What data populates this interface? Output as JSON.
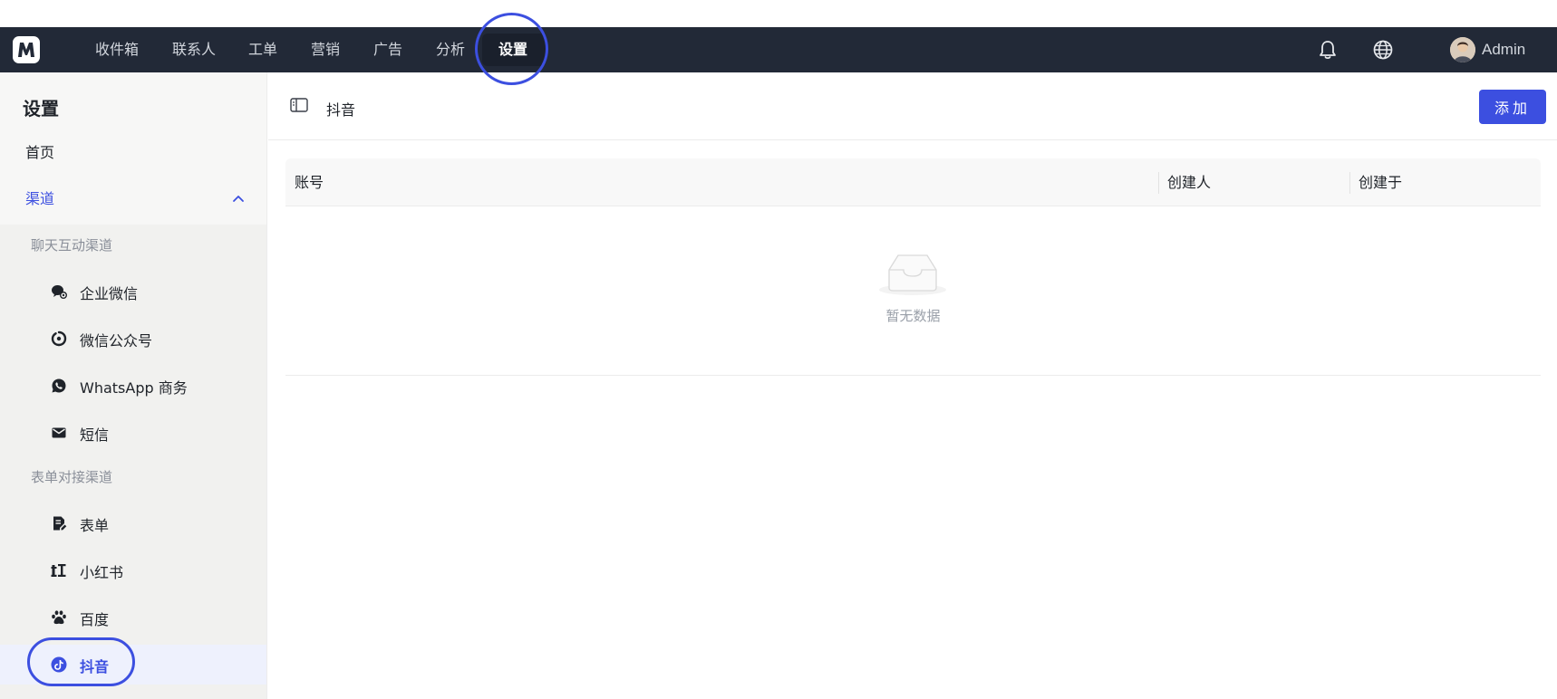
{
  "topnav": {
    "items": [
      "收件箱",
      "联系人",
      "工单",
      "营销",
      "广告",
      "分析",
      "设置"
    ],
    "active_label": "设置",
    "user_name": "Admin"
  },
  "sidebar": {
    "title": "设置",
    "home_label": "首页",
    "channels_label": "渠道",
    "chat_group_label": "聊天互动渠道",
    "chat_channels": [
      {
        "label": "企业微信",
        "icon": "wecom-icon"
      },
      {
        "label": "微信公众号",
        "icon": "wechat-official-icon"
      },
      {
        "label": "WhatsApp 商务",
        "icon": "whatsapp-icon"
      },
      {
        "label": "短信",
        "icon": "sms-icon"
      }
    ],
    "form_group_label": "表单对接渠道",
    "form_channels": [
      {
        "label": "表单",
        "icon": "form-icon"
      },
      {
        "label": "小红书",
        "icon": "xiaohongshu-icon"
      },
      {
        "label": "百度",
        "icon": "baidu-icon"
      },
      {
        "label": "抖音",
        "icon": "douyin-icon"
      }
    ],
    "active_channel": "抖音"
  },
  "main": {
    "title": "抖音",
    "add_button": "添加",
    "table": {
      "columns": [
        "账号",
        "创建人",
        "创建于"
      ],
      "rows": [],
      "empty_text": "暂无数据"
    }
  },
  "colors": {
    "topbar": "#222937",
    "accent": "#3c4fe0",
    "sidebar_bg": "#f7f7f6"
  }
}
